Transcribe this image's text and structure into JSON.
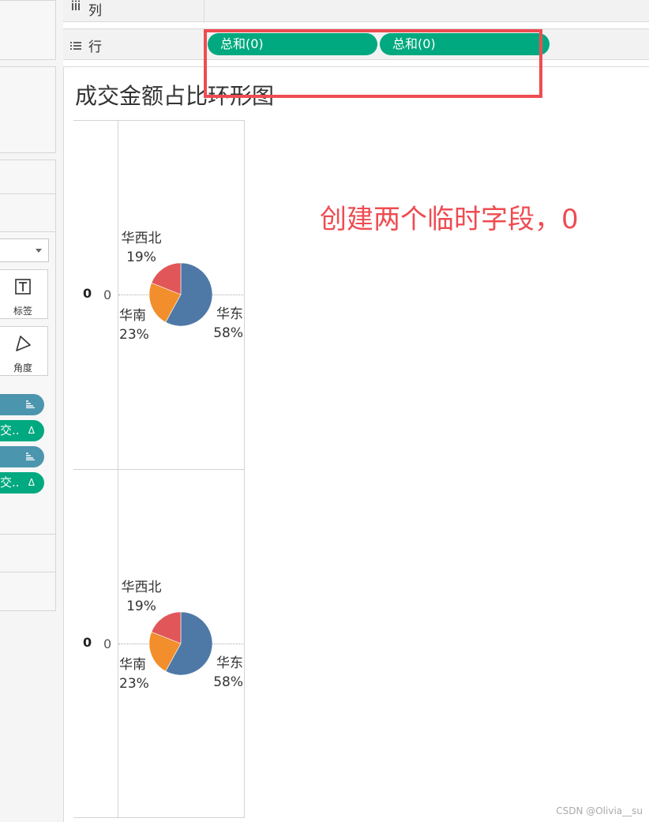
{
  "shelves": {
    "columns": {
      "icon": "columns-icon",
      "label": "列"
    },
    "rows": {
      "icon": "rows-icon",
      "label": "行",
      "pills": [
        "总和(0)",
        "总和(0)"
      ]
    }
  },
  "marks": {
    "label_card": "标签",
    "angle_card": "角度",
    "pills": [
      "",
      "交..",
      "",
      "交.."
    ]
  },
  "view": {
    "title": "成交金额占比环形图",
    "axis_header": "0",
    "axis_tick": "0"
  },
  "annotation": {
    "text": "创建两个临时字段，0"
  },
  "watermark": "CSDN @Olivia__su",
  "colors": {
    "green_pill": "#00a97f",
    "blue_pill": "#4c95ae",
    "annotation_red": "#ee4c52"
  },
  "chart_data": [
    {
      "type": "pie",
      "categories": [
        "华东",
        "华南",
        "华西北"
      ],
      "values": [
        58,
        23,
        19
      ],
      "labels": [
        "58%",
        "23%",
        "19%"
      ],
      "colors": [
        "#4e79a7",
        "#f28e2b",
        "#e15759"
      ]
    },
    {
      "type": "pie",
      "categories": [
        "华东",
        "华南",
        "华西北"
      ],
      "values": [
        58,
        23,
        19
      ],
      "labels": [
        "58%",
        "23%",
        "19%"
      ],
      "colors": [
        "#4e79a7",
        "#f28e2b",
        "#e15759"
      ]
    }
  ]
}
